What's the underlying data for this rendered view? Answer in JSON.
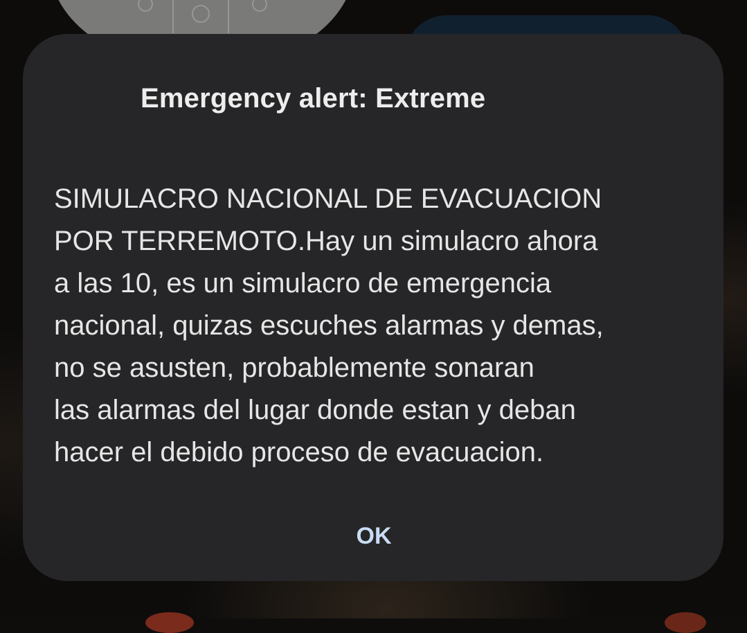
{
  "dialog": {
    "title": "Emergency alert: Extreme",
    "message_lines": [
      "SIMULACRO NACIONAL DE EVACUACION",
      "POR TERREMOTO.Hay un simulacro ahora",
      "a las 10, es un simulacro de emergencia",
      "nacional, quizas escuches alarmas y demas,",
      "no se asusten, probablemente sonaran",
      "las alarmas del lugar donde estan y deban",
      "hacer el debido proceso de evacuacion."
    ],
    "ok_label": "OK"
  },
  "colors": {
    "dialog_background": "#262628",
    "title_text": "#ededed",
    "body_text": "#e6e6e6",
    "button_accent": "#c9dcf5"
  }
}
